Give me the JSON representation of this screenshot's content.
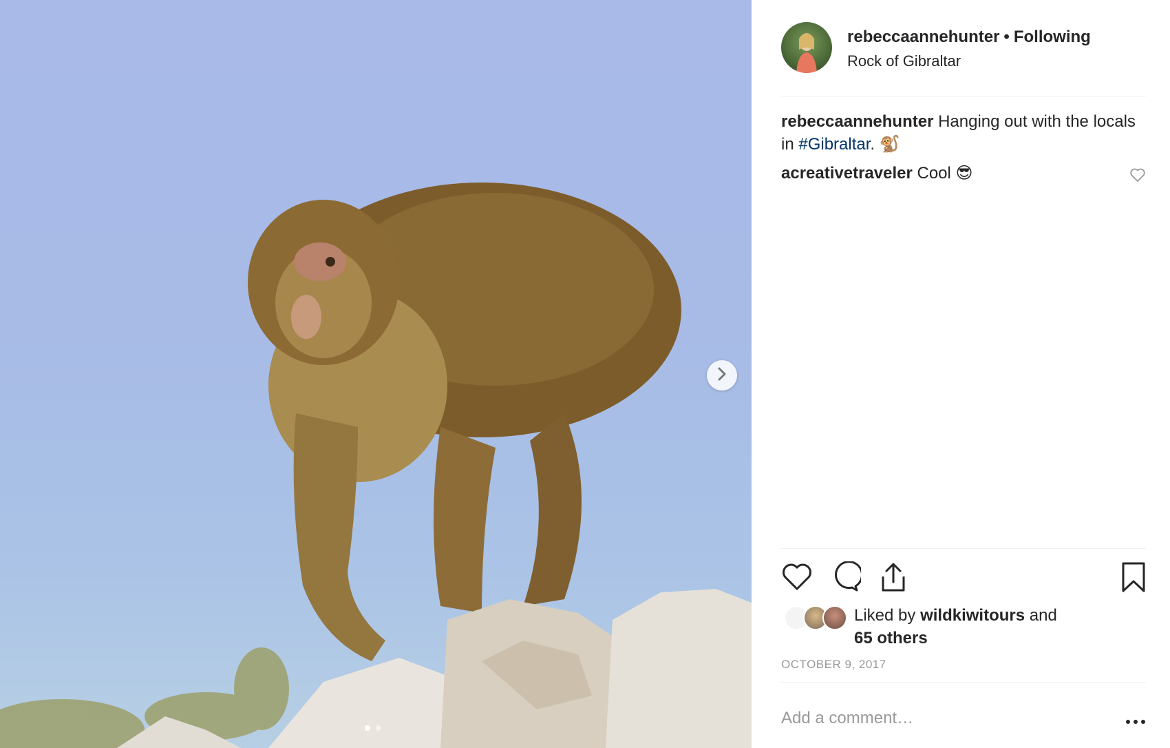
{
  "post": {
    "photo_alt": "",
    "carousel": {
      "slide_count": 2,
      "current": 1
    }
  },
  "header": {
    "username": "rebeccaannehunter",
    "separator": "•",
    "follow_status": "Following",
    "location": "Rock of Gibraltar"
  },
  "caption": {
    "username": "rebeccaannehunter",
    "text_before": "Hanging out with the locals in",
    "hashtag": "#Gibraltar",
    "text_after": ". 🐒"
  },
  "comments": [
    {
      "username": "acreativetraveler",
      "text": "Cool 😎"
    }
  ],
  "likes": {
    "prefix": "Liked by",
    "liker": "wildkiwitours",
    "suffix": "and",
    "others": "65 others"
  },
  "date": "OCTOBER 9, 2017",
  "add_comment": {
    "placeholder": "Add a comment…"
  },
  "icons": {
    "like": "heart-icon",
    "comment": "comment-icon",
    "share": "share-icon",
    "save": "bookmark-icon",
    "more": "more-options-icon",
    "next": "chevron-right-icon"
  },
  "colors": {
    "hashtag": "#003569",
    "muted": "#999999",
    "text": "#262626"
  }
}
